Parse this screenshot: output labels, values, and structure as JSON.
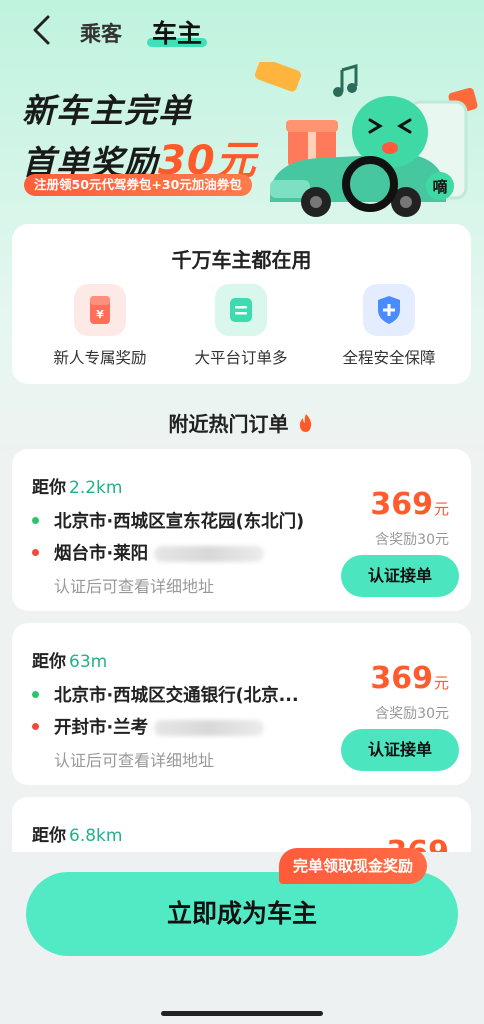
{
  "header": {
    "tab_passenger": "乘客",
    "tab_driver": "车主",
    "active_tab": "车主",
    "accent_color": "#3fe1b9"
  },
  "banner": {
    "title_line1": "新车主完单",
    "title_line2_prefix": "首单奖励",
    "title_line2_amount": "30元",
    "subtitle": "注册领50元代驾券包+30元加油券包",
    "art_text": "嘀"
  },
  "features": {
    "title": "千万车主都在用",
    "items": [
      {
        "label": "新人专属奖励",
        "icon": "red-envelope-icon",
        "color": "#ff6f5c"
      },
      {
        "label": "大平台订单多",
        "icon": "document-icon",
        "color": "#3ddcb0"
      },
      {
        "label": "全程安全保障",
        "icon": "shield-plus-icon",
        "color": "#4a8bff"
      }
    ]
  },
  "hot_orders": {
    "title": "附近热门订单",
    "hint_text": "认证后可查看详细地址",
    "accept_label": "认证接单",
    "orders": [
      {
        "dist_prefix": "距你",
        "distance": "2.2km",
        "from": "北京市·西城区宣东花园(东北门)",
        "to": "烟台市·莱阳",
        "price": "369",
        "price_unit": "元",
        "bonus": "含奖励30元"
      },
      {
        "dist_prefix": "距你",
        "distance": "63m",
        "from": "北京市·西城区交通银行(北京...",
        "to": "开封市·兰考",
        "price": "369",
        "price_unit": "元",
        "bonus": "含奖励30元"
      },
      {
        "dist_prefix": "距你",
        "distance": "6.8km",
        "price": "369"
      }
    ]
  },
  "cta": {
    "label": "立即成为车主",
    "bubble": "完单领取现金奖励"
  }
}
